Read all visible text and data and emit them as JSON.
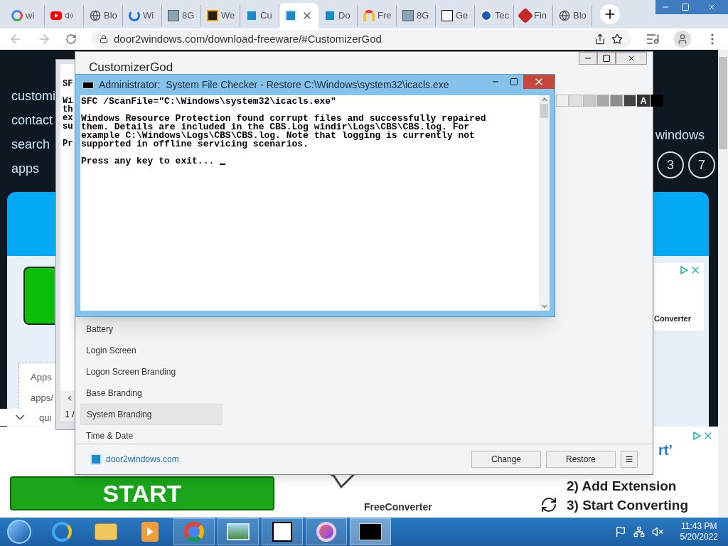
{
  "browser": {
    "tabs": [
      {
        "kind": "google",
        "label": "wi",
        "selected": false
      },
      {
        "kind": "youtube",
        "audio": true,
        "selected": false
      },
      {
        "kind": "globe",
        "label": "Blo",
        "selected": false
      },
      {
        "kind": "swirl",
        "label": "Wi",
        "selected": false
      },
      {
        "kind": "pc",
        "label": "8G",
        "selected": false
      },
      {
        "kind": "wedge",
        "label": "We",
        "selected": false
      },
      {
        "kind": "app",
        "label": "Cu",
        "selected": false
      },
      {
        "kind": "app",
        "selected": true
      },
      {
        "kind": "app",
        "label": "Do",
        "selected": false
      },
      {
        "kind": "rainbow",
        "label": "Fre",
        "selected": false
      },
      {
        "kind": "pc",
        "label": "8G",
        "selected": false
      },
      {
        "kind": "w",
        "label": "Ge",
        "selected": false
      },
      {
        "kind": "triangle",
        "label": "Tec",
        "selected": false
      },
      {
        "kind": "pin",
        "label": "Fin",
        "selected": false
      },
      {
        "kind": "globe",
        "label": "Blo",
        "selected": false
      }
    ],
    "url": "door2windows.com/download-freeware/#CustomizerGod"
  },
  "webpage": {
    "nav": [
      "customi",
      "contact",
      "search",
      "apps"
    ],
    "heading": "windows",
    "badges": [
      "3",
      "7"
    ],
    "ad_text": "Converter",
    "box_lines": [
      "Apps",
      "apps/",
      "qui"
    ],
    "start": "START",
    "ad_partial": "rt’",
    "steps": [
      "2) Add Extension",
      "3) Start Converting"
    ],
    "brand": "FreeConverter"
  },
  "back_console": {
    "lines": [
      "SF",
      "Wi",
      "th",
      "ex",
      "su",
      "Pr"
    ],
    "page": "1 /"
  },
  "customizer": {
    "title": "CustomizerGod",
    "swatch_label": "A",
    "items": [
      {
        "label": "Battery",
        "selected": false
      },
      {
        "label": "Login Screen",
        "selected": false
      },
      {
        "label": "Logon Screen Branding",
        "selected": false
      },
      {
        "label": "Base Branding",
        "selected": false
      },
      {
        "label": "System Branding",
        "selected": true
      },
      {
        "label": "Time & Date",
        "selected": false
      }
    ],
    "link": "door2windows.com",
    "buttons": [
      "Change",
      "Restore"
    ]
  },
  "console": {
    "title": "Administrator:  System File Checker - Restore C:\\Windows\\system32\\icacls.exe",
    "paragraphs": [
      [
        "SFC /ScanFile=\"C:\\Windows\\system32\\icacls.exe\""
      ],
      [
        "Windows Resource Protection found corrupt files and successfully repaired",
        "them. Details are included in the CBS.Log windir\\Logs\\CBS\\CBS.log. For",
        "example C:\\Windows\\Logs\\CBS\\CBS.log. Note that logging is currently not",
        "supported in offline servicing scenarios."
      ],
      [
        "Press any key to exit..."
      ]
    ],
    "cursor": true
  },
  "taskbar": {
    "apps": [
      {
        "kind": "ie",
        "running": false,
        "selected": false
      },
      {
        "kind": "explorer",
        "running": false,
        "selected": false
      },
      {
        "kind": "media",
        "running": false,
        "selected": false
      },
      {
        "kind": "chrome",
        "running": true,
        "selected": false
      },
      {
        "kind": "photos",
        "running": true,
        "selected": false
      },
      {
        "kind": "archive",
        "running": true,
        "selected": false
      },
      {
        "kind": "gear",
        "running": true,
        "selected": false
      },
      {
        "kind": "cmd",
        "running": true,
        "selected": true
      }
    ],
    "time": "11:43 PM",
    "date": "5/20/2022"
  }
}
